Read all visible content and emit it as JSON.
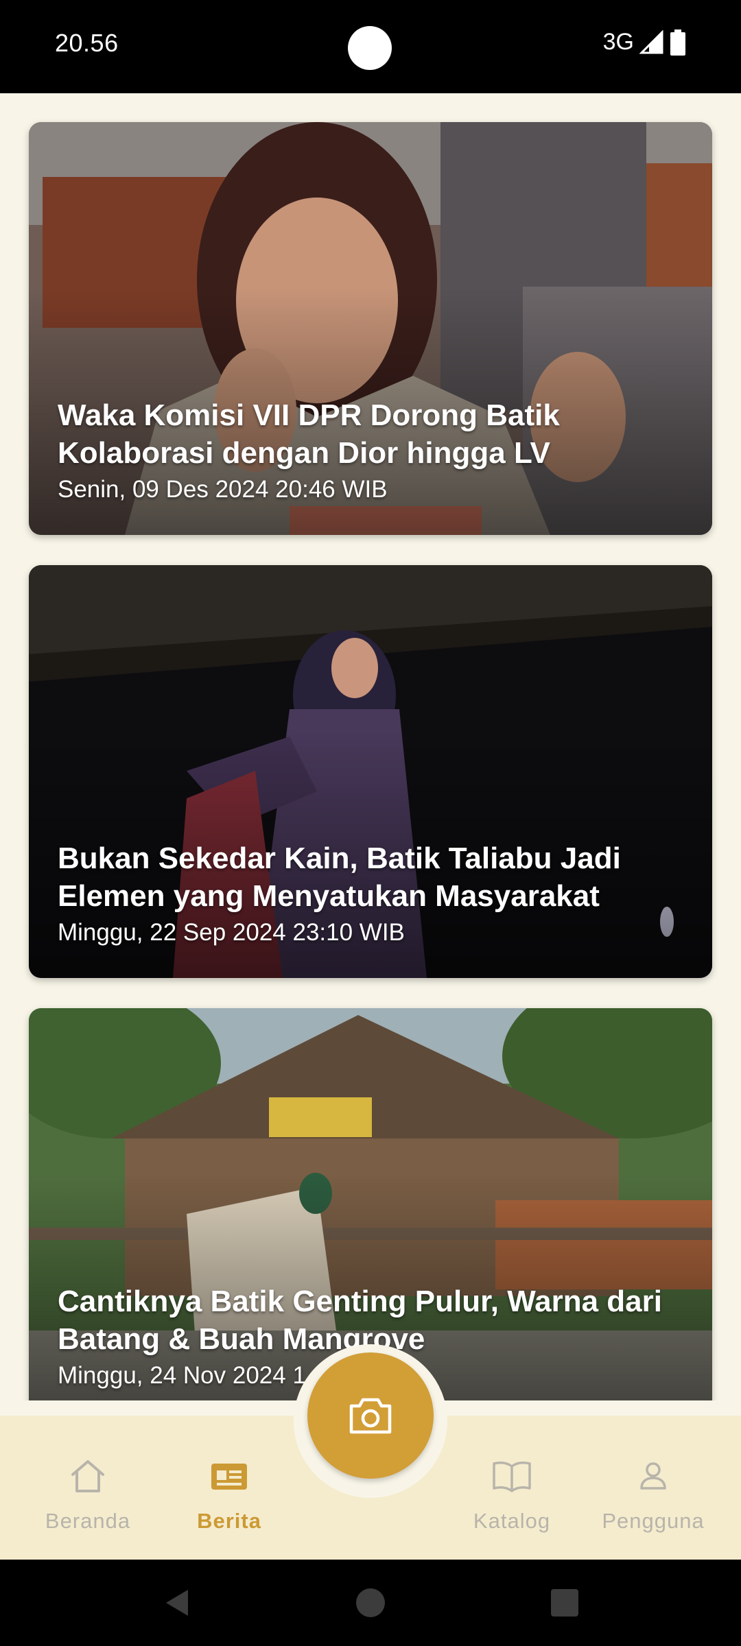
{
  "status_bar": {
    "time": "20.56",
    "network": "3G"
  },
  "news": [
    {
      "title": "Waka Komisi VII DPR Dorong Batik Kolaborasi dengan Dior hingga LV",
      "date": "Senin, 09 Des 2024 20:46 WIB"
    },
    {
      "title": "Bukan Sekedar Kain, Batik Taliabu Jadi Elemen yang Menyatukan Masyarakat",
      "date": "Minggu, 22 Sep 2024 23:10 WIB"
    },
    {
      "title": "Cantiknya Batik Genting Pulur, Warna dari Batang & Buah Mangrove",
      "date": "Minggu, 24 Nov 2024 1"
    }
  ],
  "bottom_nav": {
    "items": [
      {
        "label": "Beranda",
        "icon": "home-icon",
        "active": false
      },
      {
        "label": "Berita",
        "icon": "newspaper-icon",
        "active": true
      },
      {
        "label": "Katalog",
        "icon": "book-icon",
        "active": false
      },
      {
        "label": "Pengguna",
        "icon": "user-icon",
        "active": false
      }
    ],
    "fab_icon": "camera-icon"
  },
  "colors": {
    "background": "#f8f5e8",
    "nav_background": "#f5ecce",
    "accent": "#d29e36",
    "inactive": "#b8b4aa"
  }
}
